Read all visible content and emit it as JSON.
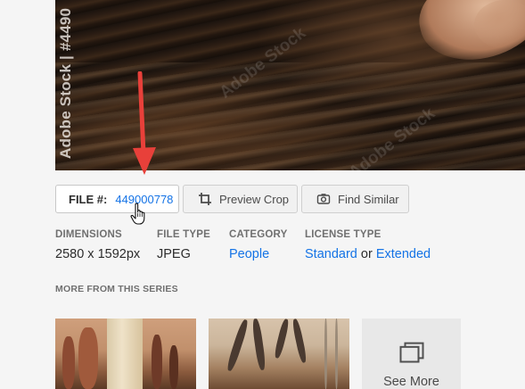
{
  "preview": {
    "vertical_caption": "Adobe Stock | #4490",
    "watermark": "Adobe Stock"
  },
  "file": {
    "label": "FILE #:",
    "number": "449000778"
  },
  "actions": {
    "preview_crop": "Preview Crop",
    "find_similar": "Find Similar"
  },
  "details": {
    "dimensions": {
      "heading": "DIMENSIONS",
      "value": "2580 x 1592px"
    },
    "file_type": {
      "heading": "FILE TYPE",
      "value": "JPEG"
    },
    "category": {
      "heading": "CATEGORY",
      "value": "People"
    },
    "license_type": {
      "heading": "LICENSE TYPE",
      "standard": "Standard",
      "or": "or",
      "extended": "Extended"
    }
  },
  "series": {
    "title": "MORE FROM THIS SERIES",
    "see_more": "See More"
  },
  "colors": {
    "link": "#1473e6",
    "arrow": "#e8403a",
    "background": "#f5f5f5"
  }
}
